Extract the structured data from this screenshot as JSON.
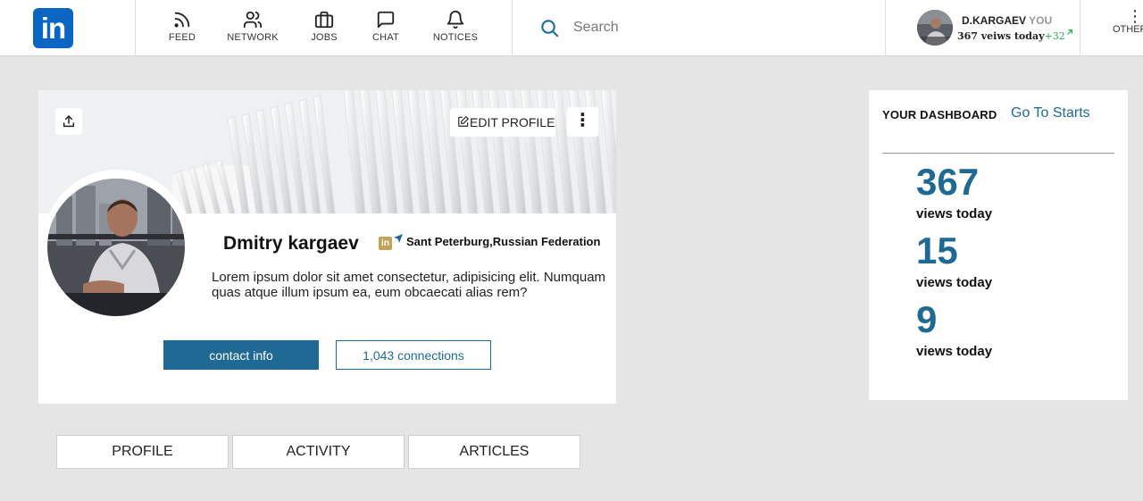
{
  "brand": {
    "logo_text": "in",
    "color": "#0a66c2"
  },
  "nav": {
    "items": [
      {
        "label": "FEED",
        "icon": "rss-icon"
      },
      {
        "label": "NETWORK",
        "icon": "people-icon"
      },
      {
        "label": "JOBS",
        "icon": "briefcase-icon"
      },
      {
        "label": "CHAT",
        "icon": "chat-icon"
      },
      {
        "label": "NOTICES",
        "icon": "bell-icon"
      }
    ]
  },
  "search": {
    "placeholder": "Search",
    "value": ""
  },
  "me": {
    "name": "D.KARGAEV",
    "you_label": "YOU",
    "stats_text": "367 veiws today",
    "delta": "+32",
    "others_label": "OTHERS"
  },
  "profile": {
    "edit_label": "EDIT PROFILE",
    "name": "Dmitry kargaev",
    "badge_text": "in",
    "location": "Sant Peterburg,Russian Federation",
    "bio": "Lorem ipsum dolor sit amet consectetur, adipisicing elit. Numquam quas atque illum ipsum ea, eum obcaecati alias rem?",
    "contact_label": "contact info",
    "connections_label": "1,043 connections"
  },
  "tabs": [
    {
      "label": "PROFILE"
    },
    {
      "label": "ACTIVITY"
    },
    {
      "label": "ARTICLES"
    }
  ],
  "dashboard": {
    "title": "YOUR DASHBOARD",
    "link": "Go To Starts",
    "stats": [
      {
        "value": "367",
        "label": "views today"
      },
      {
        "value": "15",
        "label": "views today"
      },
      {
        "value": "9",
        "label": "views today"
      }
    ]
  },
  "colors": {
    "accent": "#1e6a95",
    "page_bg": "#e5e5e5",
    "delta_green": "#2eaa55",
    "badge_gold": "#c2a35a"
  }
}
